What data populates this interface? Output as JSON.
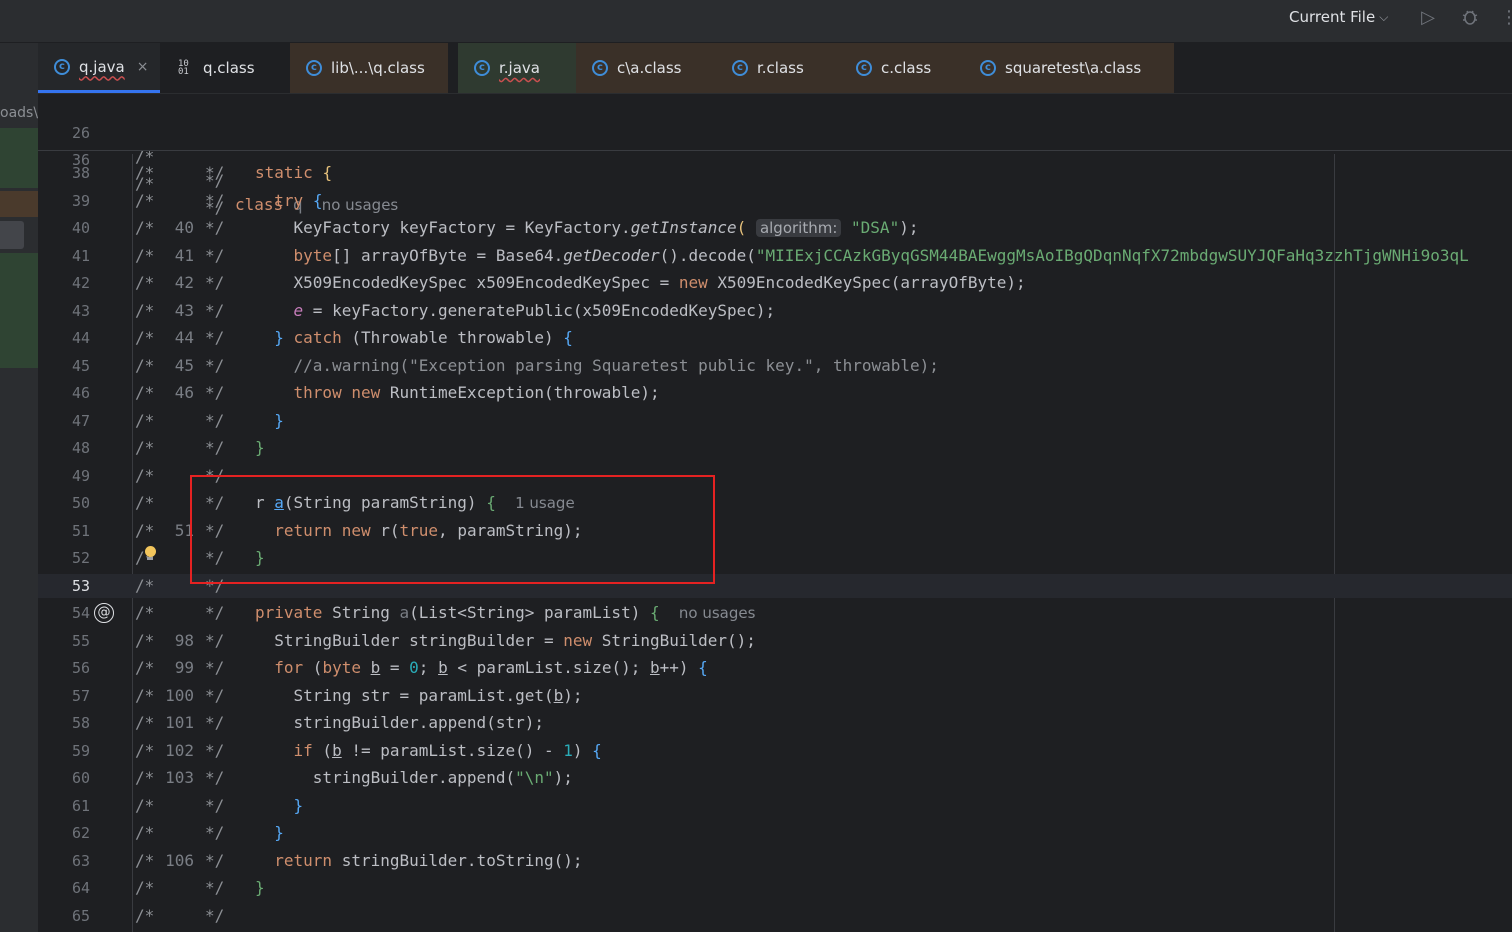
{
  "toolbar": {
    "run_config": "Current File",
    "icons": {
      "chevron": "chevron-down-icon",
      "run": "run-icon",
      "debug": "debug-icon",
      "more": "more-icon"
    }
  },
  "project_panel": {
    "path_fragment": "oads\\"
  },
  "tabs": [
    {
      "label": "q.java",
      "icon": "java-class-icon",
      "active": true
    },
    {
      "label": "q.class",
      "icon": "binary-file-icon"
    },
    {
      "label": "lib\\...\\q.class",
      "icon": "java-class-icon"
    },
    {
      "label": "r.java",
      "icon": "java-class-icon"
    },
    {
      "label": "c\\a.class",
      "icon": "java-class-icon"
    },
    {
      "label": "r.class",
      "icon": "java-class-icon"
    },
    {
      "label": "c.class",
      "icon": "java-class-icon"
    },
    {
      "label": "squaretest\\a.class",
      "icon": "java-class-icon"
    }
  ],
  "editor": {
    "comment_open": "/*",
    "comment_close": "*/",
    "sticky": [
      {
        "line": "26",
        "code_kw": "class",
        "code_name": "q",
        "hint": "no usages"
      },
      {
        "line": "36"
      }
    ],
    "lines": [
      {
        "line": "38",
        "orig": ""
      },
      {
        "line": "39",
        "orig": ""
      },
      {
        "line": "40",
        "orig": "40"
      },
      {
        "line": "41",
        "orig": "41"
      },
      {
        "line": "42",
        "orig": "42"
      },
      {
        "line": "43",
        "orig": "43"
      },
      {
        "line": "44",
        "orig": "44"
      },
      {
        "line": "45",
        "orig": "45"
      },
      {
        "line": "46",
        "orig": "46"
      },
      {
        "line": "47",
        "orig": ""
      },
      {
        "line": "48",
        "orig": ""
      },
      {
        "line": "49",
        "orig": ""
      },
      {
        "line": "50",
        "orig": ""
      },
      {
        "line": "51",
        "orig": "51"
      },
      {
        "line": "52",
        "orig": ""
      },
      {
        "line": "53",
        "orig": ""
      },
      {
        "line": "54",
        "orig": ""
      },
      {
        "line": "55",
        "orig": "98"
      },
      {
        "line": "56",
        "orig": "99"
      },
      {
        "line": "57",
        "orig": "100"
      },
      {
        "line": "58",
        "orig": "101"
      },
      {
        "line": "59",
        "orig": "102"
      },
      {
        "line": "60",
        "orig": "103"
      },
      {
        "line": "61",
        "orig": ""
      },
      {
        "line": "62",
        "orig": ""
      },
      {
        "line": "63",
        "orig": "106"
      },
      {
        "line": "64",
        "orig": ""
      },
      {
        "line": "65",
        "orig": ""
      }
    ],
    "tokens": {
      "static_kw": "static",
      "brace_open": "{",
      "brace_close": "}",
      "try_kw": "try",
      "l40_a": "KeyFactory keyFactory = KeyFactory.",
      "l40_method": "getInstance",
      "l40_paren": "(",
      "l40_hint": "algorithm:",
      "l40_str": "\"DSA\"",
      "l40_end": ");",
      "l41_type": "byte",
      "l41_a": "[] arrayOfByte = Base64.",
      "l41_method": "getDecoder",
      "l41_b": "().decode(",
      "l41_str": "\"MIIExjCCAzkGByqGSM44BAEwggMsAoIBgQDqnNqfX72mbdgwSUYJQFaHq3zzhTjgWNHi9o3qL",
      "l42_a": "X509EncodedKeySpec x509EncodedKeySpec = ",
      "l42_new": "new",
      "l42_b": " X509EncodedKeySpec(arrayOfByte);",
      "l43_field": "e",
      "l43_a": " = keyFactory.generatePublic(x509EncodedKeySpec);",
      "l44_close": "}",
      "l44_catch": "catch",
      "l44_a": " (Throwable throwable) ",
      "l45_comment": "//a.warning(\"Exception parsing Squaretest public key.\", throwable);",
      "l46_throw": "throw",
      "l46_new": "new",
      "l46_a": " RuntimeException(throwable);",
      "l50_type": "r ",
      "l50_name": "a",
      "l50_a": "(String paramString) ",
      "l50_hint": "1 usage",
      "l51_return": "return",
      "l51_new": "new",
      "l51_a": " r(",
      "l51_true": "true",
      "l51_b": ", paramString);",
      "l54_private": "private",
      "l54_a": " String ",
      "l54_name": "a",
      "l54_b": "(List<String> paramList) ",
      "l54_hint": "no usages",
      "l55_a": "StringBuilder stringBuilder = ",
      "l55_new": "new",
      "l55_b": " StringBuilder();",
      "l56_for": "for",
      "l56_a": " (",
      "l56_byte": "byte",
      "l56_b": " ",
      "l56_var1": "b",
      "l56_c": " = ",
      "l56_zero": "0",
      "l56_d": "; ",
      "l56_var2": "b",
      "l56_e": " < paramList.size(); ",
      "l56_var3": "b",
      "l56_f": "++) ",
      "l57_a": "String str = paramList.get(",
      "l57_var": "b",
      "l57_b": ");",
      "l58_a": "stringBuilder.append(str);",
      "l59_if": "if",
      "l59_a": " (",
      "l59_var": "b",
      "l59_b": " != paramList.size() - ",
      "l59_one": "1",
      "l59_c": ") ",
      "l60_a": "stringBuilder.append(",
      "l60_str": "\"\\n\"",
      "l60_b": ");",
      "l63_return": "return",
      "l63_a": " stringBuilder.toString();"
    }
  }
}
